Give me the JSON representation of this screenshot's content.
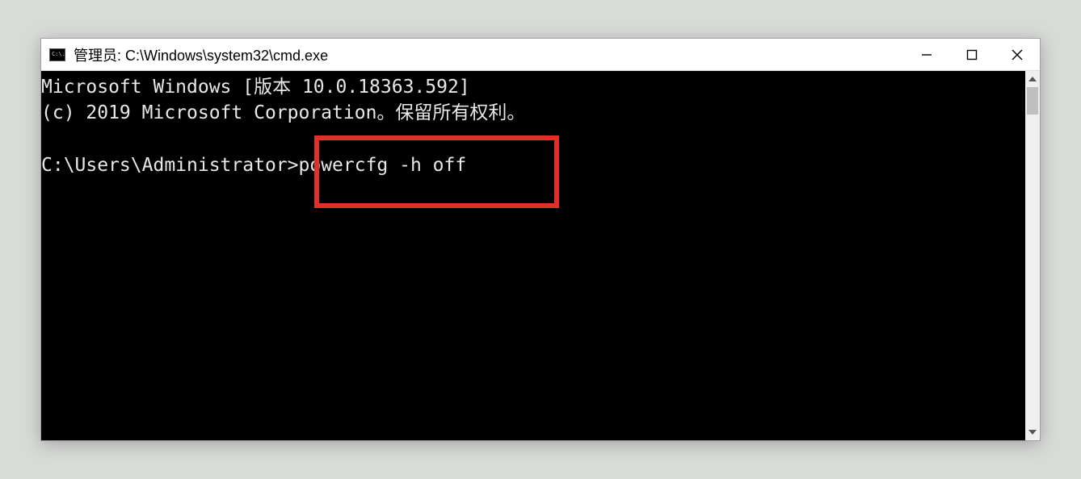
{
  "window": {
    "title": "管理员: C:\\Windows\\system32\\cmd.exe",
    "icon_text": "C:\\."
  },
  "terminal": {
    "line1": "Microsoft Windows [版本 10.0.18363.592]",
    "line2": "(c) 2019 Microsoft Corporation。保留所有权利。",
    "blank": "",
    "prompt": "C:\\Users\\Administrator>",
    "command": "powercfg -h off"
  },
  "annotation": {
    "highlight_target": "powercfg -h off"
  }
}
